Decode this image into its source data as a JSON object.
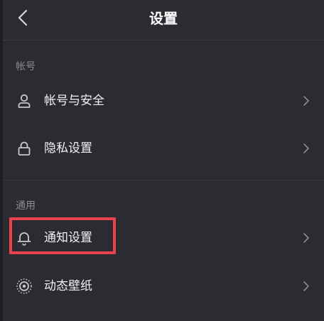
{
  "header": {
    "title": "设置",
    "back_icon": "chevron-left-icon"
  },
  "sections": [
    {
      "title": "帐号",
      "items": [
        {
          "label": "帐号与安全",
          "icon": "user-icon"
        },
        {
          "label": "隐私设置",
          "icon": "lock-icon"
        }
      ]
    },
    {
      "title": "通用",
      "items": [
        {
          "label": "通知设置",
          "icon": "bell-icon"
        },
        {
          "label": "动态壁纸",
          "icon": "wallpaper-icon"
        }
      ]
    }
  ],
  "colors": {
    "background": "#2b2c32",
    "text": "#f2f2f4",
    "section_text": "#8a8b90",
    "highlight": "#e9434c"
  }
}
